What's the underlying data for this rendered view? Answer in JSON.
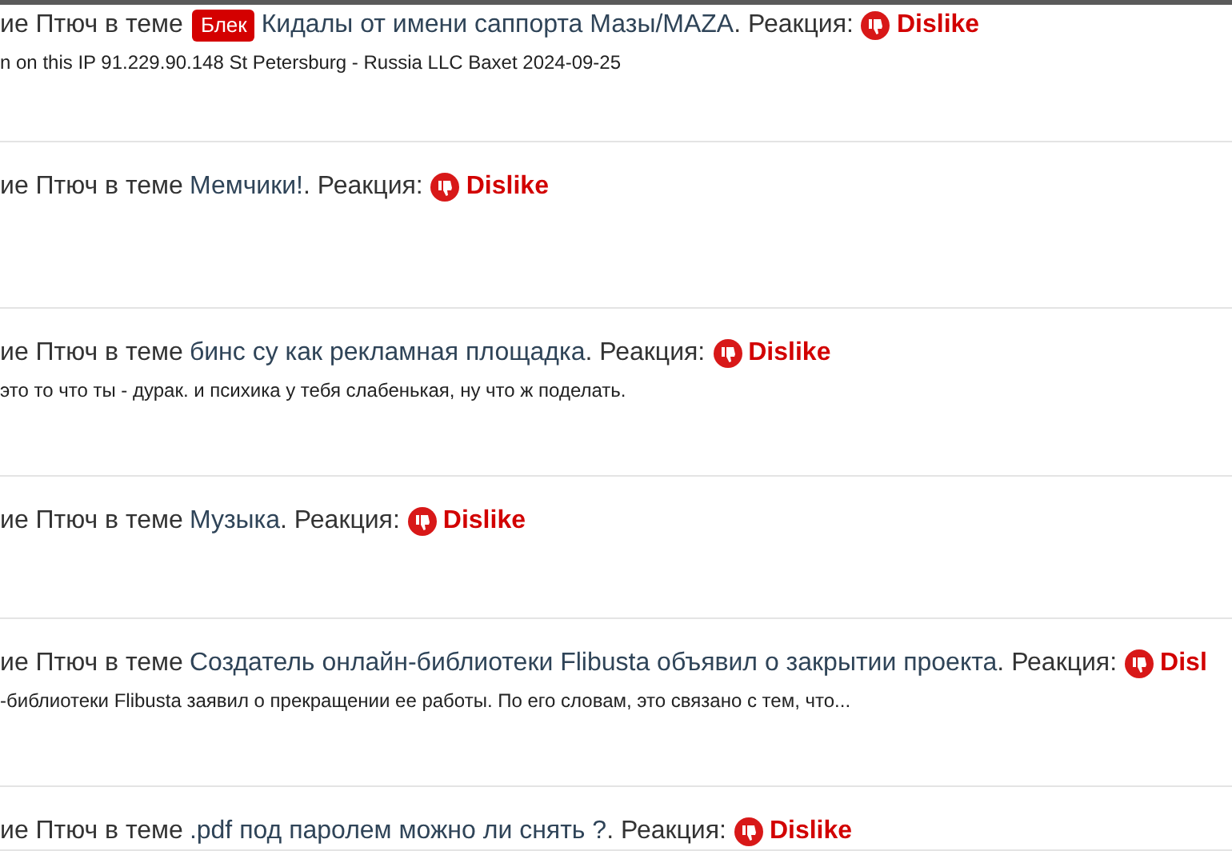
{
  "items": [
    {
      "prefix": "ие Птюч в теме",
      "badge": "Блек",
      "thread": "Кидалы от имени саппорта Мазы/MAZA",
      "suffix": ". Реакция:",
      "reaction": "Dislike",
      "snippet": "n on this IP 91.229.90.148 St Petersburg - Russia LLC Baxet 2024-09-25"
    },
    {
      "prefix": "ие Птюч в теме",
      "thread": "Мемчики!",
      "suffix": ". Реакция:",
      "reaction": "Dislike"
    },
    {
      "prefix": "ие Птюч в теме",
      "thread": "бинс су как рекламная площадка",
      "suffix": ". Реакция:",
      "reaction": "Dislike",
      "snippet": "это то что ты - дурак. и психика у тебя слабенькая, ну что ж поделать."
    },
    {
      "prefix": "ие Птюч в теме",
      "thread": "Музыка",
      "suffix": ". Реакция:",
      "reaction": "Dislike"
    },
    {
      "prefix": "ие Птюч в теме",
      "thread": "Создатель онлайн-библиотеки Flibusta объявил о закрытии проекта",
      "suffix": ". Реакция:",
      "reaction": "Disl",
      "snippet": "-библиотеки Flibusta заявил о прекращении ее работы. По его словам, это связано с тем, что..."
    },
    {
      "prefix": "ие Птюч в теме",
      "thread": ".pdf под паролем можно ли снять ?",
      "suffix": ". Реакция:",
      "reaction": "Dislike"
    }
  ]
}
